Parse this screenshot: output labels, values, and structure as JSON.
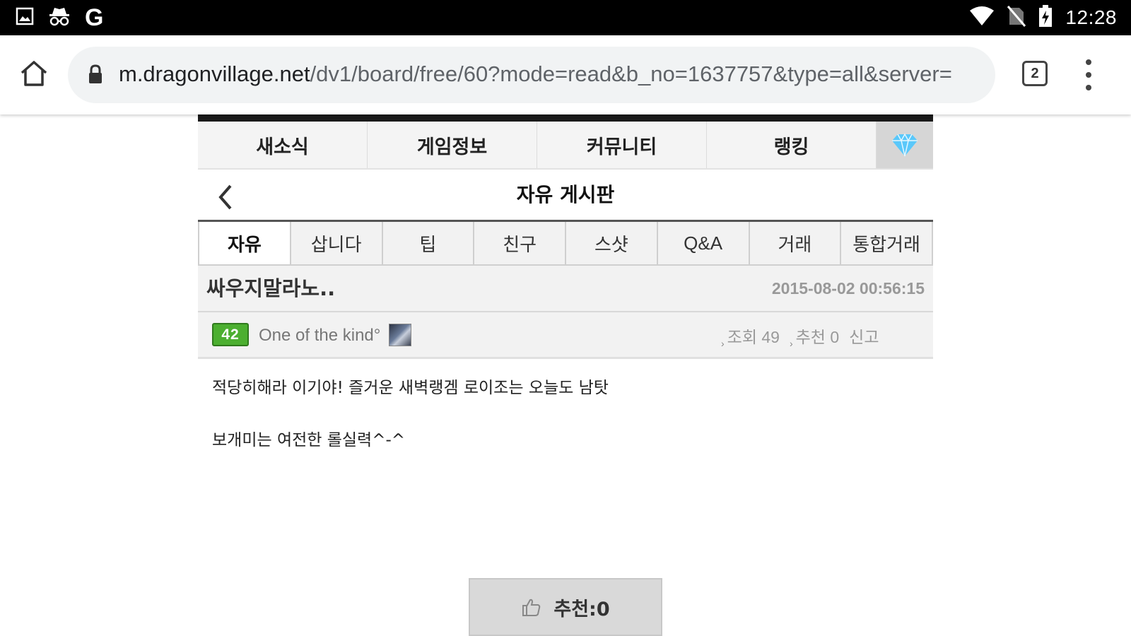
{
  "status_bar": {
    "time": "12:28",
    "left_icons": [
      "image-icon",
      "incognito-icon",
      "google-icon"
    ],
    "google_letter": "G",
    "right_icons": [
      "wifi-icon",
      "no-sim-icon",
      "battery-charging-icon"
    ]
  },
  "browser": {
    "url_domain": "m.dragonvillage.net",
    "url_path": "/dv1/board/free/60?mode=read&b_no=1637757&type=all&server=",
    "tab_count": "2"
  },
  "site": {
    "main_nav": [
      "새소식",
      "게임정보",
      "커뮤니티",
      "랭킹"
    ],
    "gem_icon_color": "#5ac8fa",
    "board_title": "자유 게시판",
    "sub_tabs": [
      "자유",
      "삽니다",
      "팁",
      "친구",
      "스샷",
      "Q&A",
      "거래",
      "통합거래"
    ],
    "active_sub_tab": "자유"
  },
  "post": {
    "title": "싸우지말라노..",
    "date": "2015-08-02 00:56:15",
    "author": {
      "level": "42",
      "name": "One of the kind°"
    },
    "stats": {
      "views": "조회 49",
      "recommend": "추천 0",
      "report": "신고"
    },
    "body_lines": [
      "적당히해라 이기야! 즐거운 새벽랭겜 로이조는 오늘도 남탓",
      "보개미는 여전한 롤실력^-^"
    ],
    "recommend_button": "추천:0"
  }
}
